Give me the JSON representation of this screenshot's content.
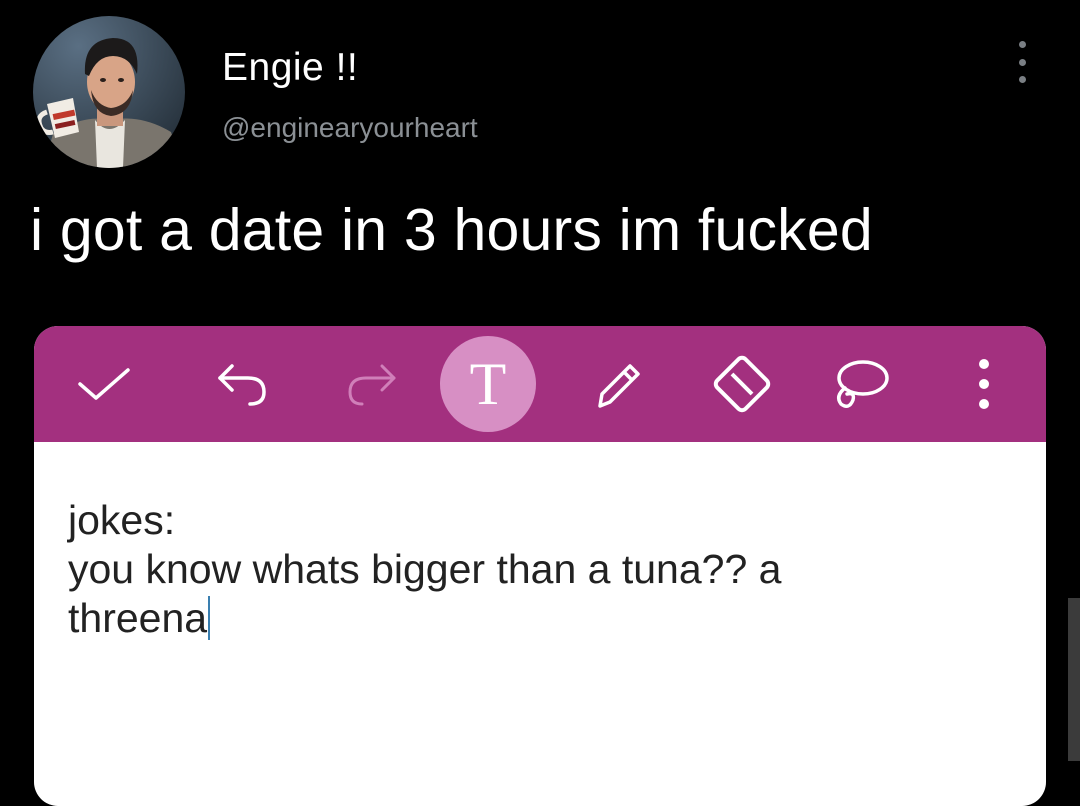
{
  "tweet": {
    "display_name": "Engie !!",
    "handle": "@enginearyourheart",
    "text": "i got a date in 3 hours im fucked",
    "more_icon": "more-vertical-icon"
  },
  "note_app": {
    "accent_color": "#a3307f",
    "toolbar": [
      {
        "name": "check-icon",
        "state": "enabled"
      },
      {
        "name": "undo-icon",
        "state": "enabled"
      },
      {
        "name": "redo-icon",
        "state": "disabled"
      },
      {
        "name": "text-tool-icon",
        "state": "selected"
      },
      {
        "name": "pen-icon",
        "state": "enabled"
      },
      {
        "name": "eraser-icon",
        "state": "enabled"
      },
      {
        "name": "lasso-icon",
        "state": "enabled"
      },
      {
        "name": "more-vertical-icon",
        "state": "enabled"
      }
    ],
    "text_tool_label": "T",
    "note_lines": [
      "jokes:",
      "you know whats bigger than a tuna?? a",
      "threena"
    ]
  }
}
